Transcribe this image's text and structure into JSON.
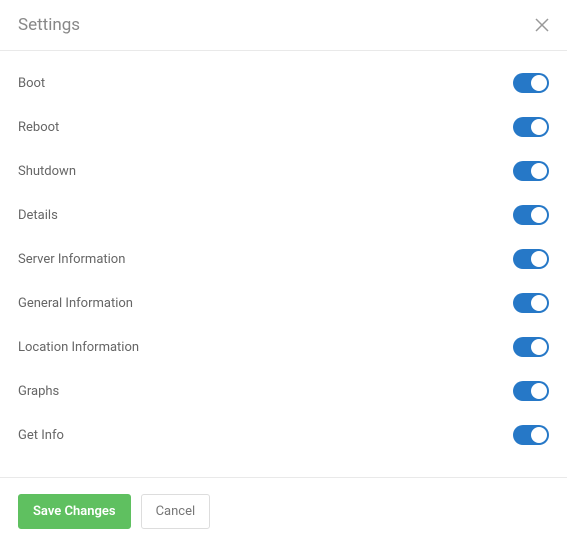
{
  "header": {
    "title": "Settings"
  },
  "settings": [
    {
      "label": "Boot",
      "enabled": true
    },
    {
      "label": "Reboot",
      "enabled": true
    },
    {
      "label": "Shutdown",
      "enabled": true
    },
    {
      "label": "Details",
      "enabled": true
    },
    {
      "label": "Server Information",
      "enabled": true
    },
    {
      "label": "General Information",
      "enabled": true
    },
    {
      "label": "Location Information",
      "enabled": true
    },
    {
      "label": "Graphs",
      "enabled": true
    },
    {
      "label": "Get Info",
      "enabled": true
    }
  ],
  "footer": {
    "save_label": "Save Changes",
    "cancel_label": "Cancel"
  }
}
